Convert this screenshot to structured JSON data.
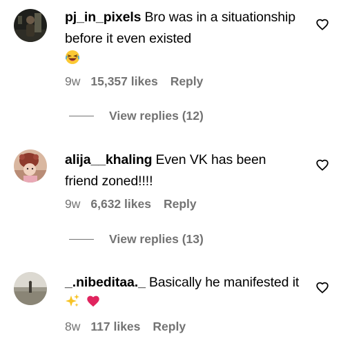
{
  "comments": [
    {
      "username": "pj_in_pixels",
      "text": "Bro was in a situationship before it even existed",
      "emoji_icon": "grinning-squinting-face-emoji",
      "time": "9w",
      "likes": "15,357 likes",
      "reply_label": "Reply",
      "view_replies": "View replies (12)"
    },
    {
      "username": "alija__khaling",
      "text": "Even VK has been friend zoned!!!!",
      "time": "9w",
      "likes": "6,632 likes",
      "reply_label": "Reply",
      "view_replies": "View replies (13)"
    },
    {
      "username": "_.nibeditaa._",
      "text": "Basically he manifested it",
      "emoji_icons": [
        "sparkles-emoji",
        "red-heart-emoji"
      ],
      "time": "8w",
      "likes": "117 likes",
      "reply_label": "Reply"
    }
  ],
  "colors": {
    "secondary_text": "#737373",
    "primary_text": "#000000",
    "heart_emoji": "#e0245e",
    "sparkle_emoji": "#f7c325"
  }
}
